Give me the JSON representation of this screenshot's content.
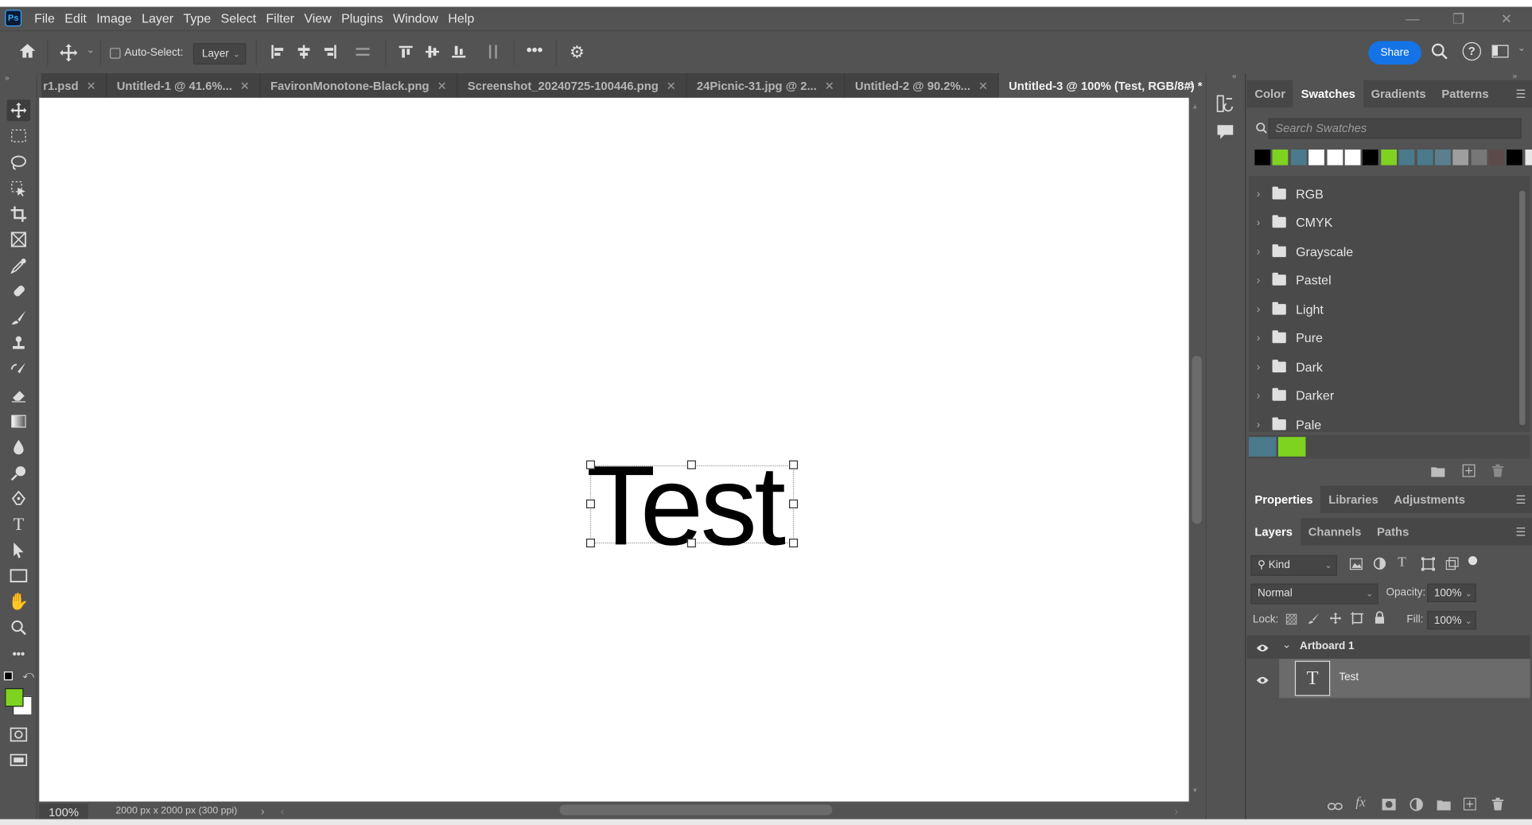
{
  "app": {
    "logo": "Ps",
    "menu": [
      "File",
      "Edit",
      "Image",
      "Layer",
      "Type",
      "Select",
      "Filter",
      "View",
      "Plugins",
      "Window",
      "Help"
    ]
  },
  "options_bar": {
    "auto_select_label": "Auto-Select:",
    "auto_select_target": "Layer",
    "share_label": "Share"
  },
  "tabs": [
    {
      "label": "r1.psd",
      "active": false
    },
    {
      "label": "Untitled-1 @ 41.6%...",
      "active": false
    },
    {
      "label": "FavironMonotone-Black.png",
      "active": false
    },
    {
      "label": "Screenshot_20240725-100446.png",
      "active": false
    },
    {
      "label": "24Picnic-31.jpg @ 2...",
      "active": false
    },
    {
      "label": "Untitled-2 @ 90.2%...",
      "active": false
    },
    {
      "label": "Untitled-3 @ 100% (Test, RGB/8#) *",
      "active": true
    }
  ],
  "canvas": {
    "text": "Test"
  },
  "status": {
    "zoom": "100%",
    "doc_info": "2000 px x 2000 px (300 ppi)"
  },
  "colors": {
    "foreground": "#7ed321",
    "background": "#ffffff",
    "accent": "#1473e6"
  },
  "color_panel": {
    "tabs": [
      "Color",
      "Swatches",
      "Gradients",
      "Patterns"
    ],
    "active_tab": "Swatches",
    "search_placeholder": "Search Swatches",
    "recent_swatches": [
      "#000000",
      "#7ed321",
      "#4a7a8c",
      "#ffffff",
      "#ffffff",
      "#ffffff",
      "#000000",
      "#7ed321",
      "#4a7a8c",
      "#4a7a8c",
      "#5b7f8f",
      "#9e9e9e",
      "#777777",
      "#5c4a4a",
      "#000000",
      "#e6e6e6"
    ],
    "groups": [
      "RGB",
      "CMYK",
      "Grayscale",
      "Pastel",
      "Light",
      "Pure",
      "Dark",
      "Darker",
      "Pale"
    ],
    "loose_swatches": [
      "#4a7a8c",
      "#7ed321"
    ]
  },
  "properties_panel": {
    "tabs": [
      "Properties",
      "Libraries",
      "Adjustments"
    ],
    "active_tab": "Properties"
  },
  "layers_panel": {
    "tabs": [
      "Layers",
      "Channels",
      "Paths"
    ],
    "active_tab": "Layers",
    "filter_kind": "Kind",
    "blend_mode": "Normal",
    "opacity_label": "Opacity:",
    "opacity_value": "100%",
    "lock_label": "Lock:",
    "fill_label": "Fill:",
    "fill_value": "100%",
    "layers": [
      {
        "name": "Artboard 1",
        "type": "artboard"
      },
      {
        "name": "Test",
        "type": "text",
        "thumb": "T"
      }
    ]
  }
}
